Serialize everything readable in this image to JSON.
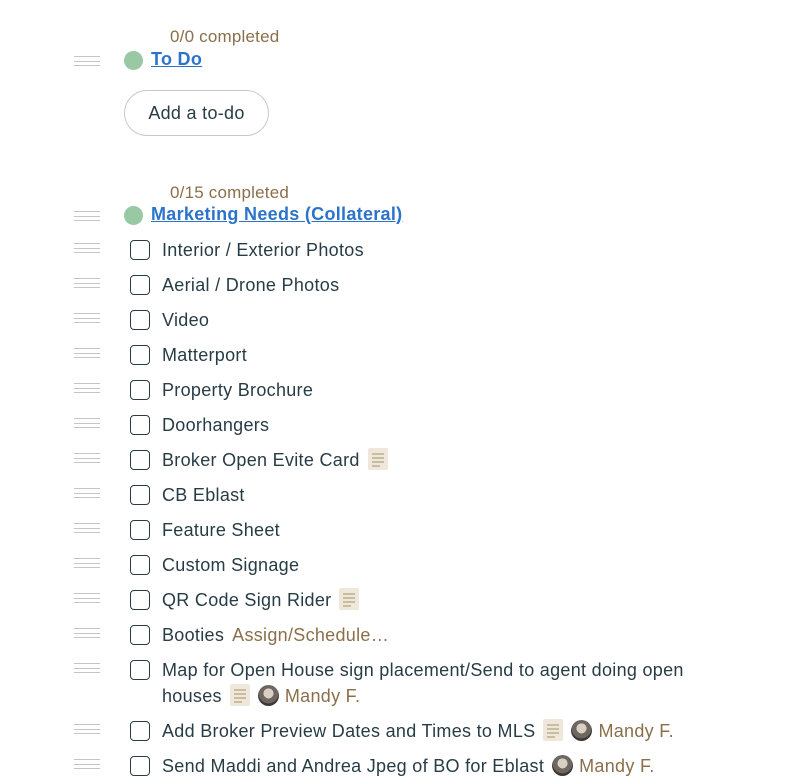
{
  "lists": [
    {
      "progress": "0/0 completed",
      "title": "To Do",
      "add_button": "Add a to-do",
      "items": []
    },
    {
      "progress": "0/15 completed",
      "title": "Marketing Needs (Collateral)",
      "items": [
        {
          "text": "Interior / Exterior Photos"
        },
        {
          "text": "Aerial / Drone Photos"
        },
        {
          "text": "Video"
        },
        {
          "text": "Matterport"
        },
        {
          "text": "Property Brochure"
        },
        {
          "text": "Doorhangers"
        },
        {
          "text": "Broker Open Evite Card",
          "note": true
        },
        {
          "text": "CB Eblast"
        },
        {
          "text": "Feature Sheet"
        },
        {
          "text": "Custom Signage"
        },
        {
          "text": "QR Code Sign Rider",
          "note": true
        },
        {
          "text": "Booties",
          "assign_link": "Assign/Schedule…"
        },
        {
          "text": "Map for Open House sign placement/Send to agent doing open houses",
          "note": true,
          "assignee": "Mandy F."
        },
        {
          "text": "Add Broker Preview Dates and Times to MLS",
          "note": true,
          "assignee": "Mandy F."
        },
        {
          "text": "Send Maddi and Andrea Jpeg of BO for Eblast",
          "assignee": "Mandy F."
        }
      ]
    }
  ],
  "icons": {
    "drag_handle": "drag-handle-icon",
    "list_dot": "status-dot-icon",
    "note": "note-icon",
    "avatar": "avatar"
  },
  "colors": {
    "link": "#2b74c9",
    "progress": "#8a6f4a",
    "dot": "#98c8a4",
    "text": "#283c46"
  }
}
